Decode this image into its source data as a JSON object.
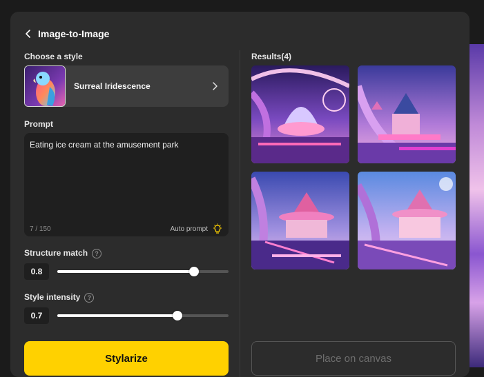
{
  "header": {
    "title": "Image-to-Image",
    "back_icon": "chevron-left-icon"
  },
  "style_section": {
    "label": "Choose a style",
    "selected_style": "Surreal Iridescence",
    "thumbnail": "parrot-image",
    "chevron_icon": "chevron-right-icon"
  },
  "prompt_section": {
    "label": "Prompt",
    "value": "Eating ice cream at the amusement park",
    "char_count": "7 / 150",
    "auto_prompt_label": "Auto prompt",
    "auto_prompt_icon": "lightbulb-icon"
  },
  "structure_match": {
    "label": "Structure match",
    "value": "0.8",
    "fraction": 0.8
  },
  "style_intensity": {
    "label": "Style intensity",
    "value": "0.7",
    "fraction": 0.7
  },
  "actions": {
    "stylarize_label": "Stylarize",
    "place_label": "Place on canvas"
  },
  "results": {
    "label": "Results(4)",
    "items": [
      "result-image-1",
      "result-image-2",
      "result-image-3",
      "result-image-4"
    ]
  },
  "colors": {
    "accent": "#ffd100",
    "panel": "#2c2c2c",
    "background": "#1b1b1b"
  }
}
